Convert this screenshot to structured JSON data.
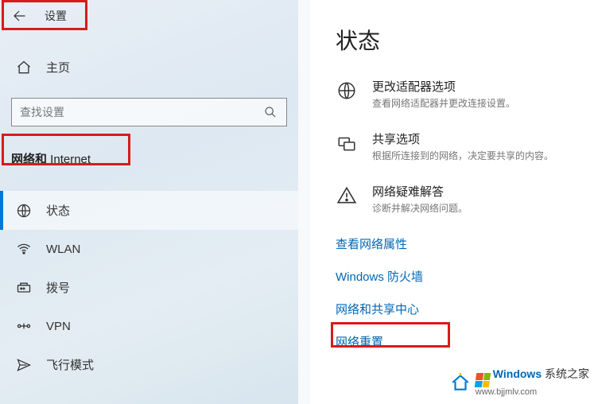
{
  "header": {
    "app_title": "设置"
  },
  "sidebar": {
    "home_label": "主页",
    "search_placeholder": "查找设置",
    "category_bold": "网络和",
    "category_rest": " Internet",
    "items": [
      {
        "label": "状态"
      },
      {
        "label": "WLAN"
      },
      {
        "label": "拨号"
      },
      {
        "label": "VPN"
      },
      {
        "label": "飞行模式"
      }
    ]
  },
  "main": {
    "title": "状态",
    "options": [
      {
        "title": "更改适配器选项",
        "sub": "查看网络适配器并更改连接设置。"
      },
      {
        "title": "共享选项",
        "sub": "根据所连接到的网络，决定要共享的内容。"
      },
      {
        "title": "网络疑难解答",
        "sub": "诊断并解决网络问题。"
      }
    ],
    "links": [
      "查看网络属性",
      "Windows 防火墙",
      "网络和共享中心",
      "网络重置"
    ]
  },
  "watermark": {
    "brand_prefix": "Windows",
    "brand_suffix": "系统之家",
    "url": "www.bjjmlv.com"
  }
}
